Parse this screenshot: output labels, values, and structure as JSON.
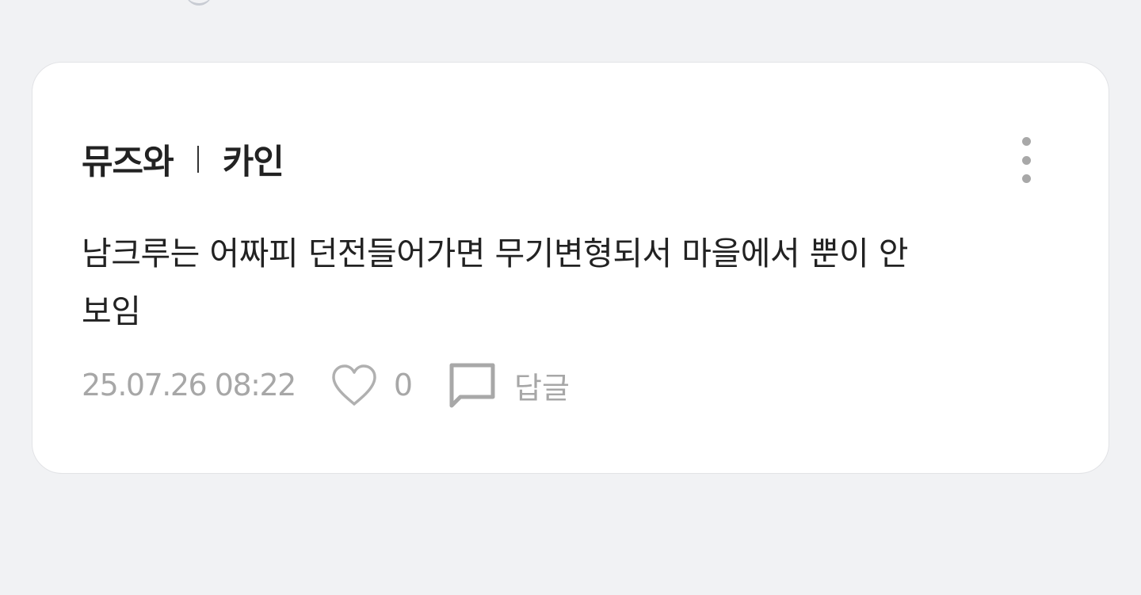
{
  "comment": {
    "author": "뮤즈와",
    "character": "카인",
    "text_line1": "남크루는 어짜피 던전들어가면 무기변형되서 마을에서 뿐이 안",
    "text_line2": "보임",
    "timestamp": "25.07.26 08:22",
    "like_count": "0",
    "reply_label": "답글"
  },
  "icons": {
    "more": "more-vertical-icon",
    "like": "heart-outline-icon",
    "reply": "speech-bubble-icon"
  },
  "colors": {
    "background": "#f1f2f4",
    "card": "#ffffff",
    "text_primary": "#222222",
    "text_muted": "#a7a7a7"
  }
}
